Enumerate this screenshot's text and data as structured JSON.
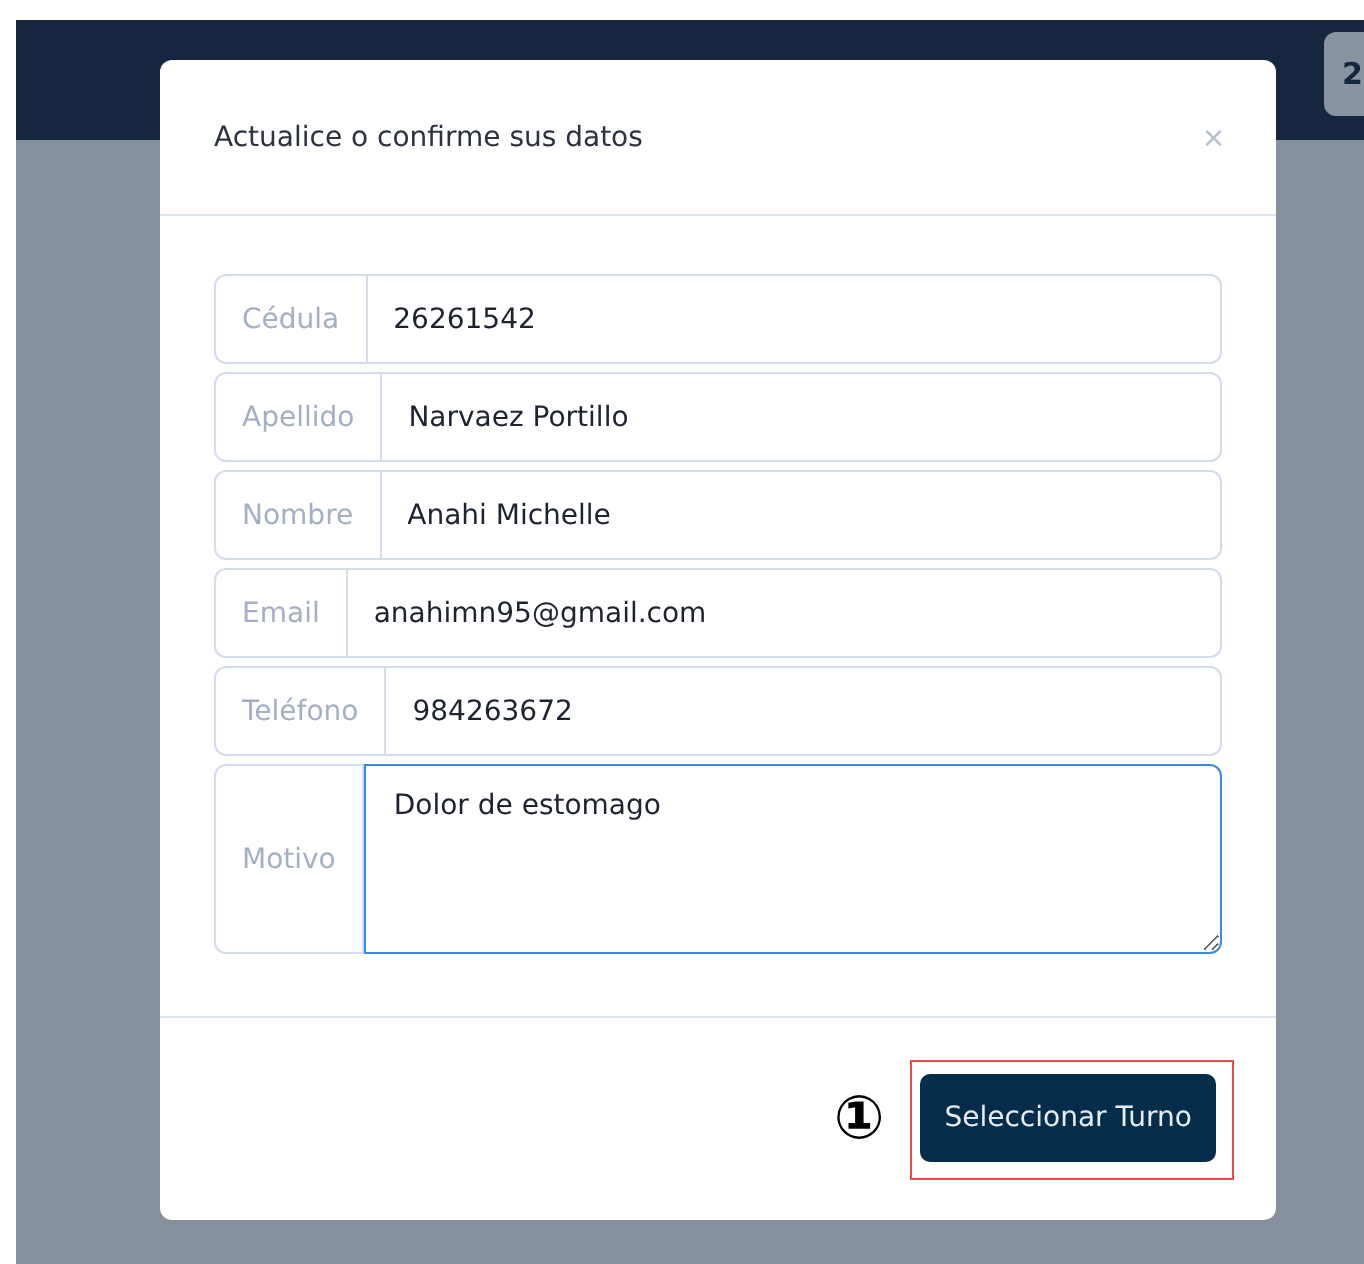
{
  "top_bar": {
    "badge": "2"
  },
  "modal": {
    "title": "Actualice o confirme sus datos",
    "close": "×",
    "fields": [
      {
        "kind": "input",
        "label": "Cédula",
        "value": "26261542",
        "focused": false
      },
      {
        "kind": "input",
        "label": "Apellido",
        "value": "Narvaez Portillo",
        "focused": false
      },
      {
        "kind": "input",
        "label": "Nombre",
        "value": "Anahi Michelle",
        "focused": false
      },
      {
        "kind": "input",
        "label": "Email",
        "value": "anahimn95@gmail.com",
        "focused": false
      },
      {
        "kind": "input",
        "label": "Teléfono",
        "value": "984263672",
        "focused": false
      },
      {
        "kind": "textarea",
        "label": "Motivo",
        "value": "Dolor de estomago",
        "focused": true
      }
    ],
    "button": "Seleccionar Turno",
    "annotation": "①"
  }
}
